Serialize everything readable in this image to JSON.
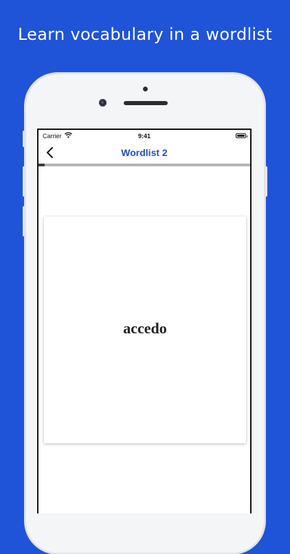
{
  "headline": "Learn vocabulary in a wordlist",
  "status_bar": {
    "carrier": "Carrier",
    "time": "9:41"
  },
  "nav": {
    "title": "Wordlist 2",
    "back_icon": "chevron-left-icon"
  },
  "progress": {
    "fraction": 0.03
  },
  "card": {
    "word": "accedo"
  },
  "colors": {
    "background": "#1f53d8",
    "title": "#1f4fc4",
    "progress_track": "#b5b5b5",
    "progress_fill": "#3a3a3a"
  }
}
